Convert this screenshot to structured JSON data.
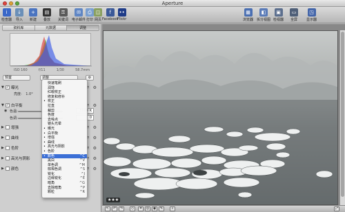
{
  "window": {
    "title": "Aperture"
  },
  "toolbar": {
    "tools": [
      {
        "id": "inspector",
        "label": "检查器",
        "icon": "inspector-icon",
        "color": "#3a68c8",
        "glyph": "i"
      },
      {
        "id": "import",
        "label": "导入",
        "icon": "import-icon",
        "color": "#6a8fb8",
        "glyph": "↓"
      },
      {
        "id": "new",
        "label": "新建",
        "icon": "new-icon",
        "color": "#4a74c0",
        "glyph": "+"
      },
      {
        "id": "stack",
        "label": "叠放",
        "icon": "stack-icon",
        "color": "#333333",
        "glyph": "▤"
      },
      {
        "id": "keywords",
        "label": "关键词",
        "icon": "keyword-icon",
        "color": "#5a5a5a",
        "glyph": "⚿"
      },
      {
        "id": "email",
        "label": "电子邮件",
        "icon": "email-icon",
        "color": "#5f86c4",
        "glyph": "✉"
      },
      {
        "id": "print",
        "label": "打印",
        "icon": "print-icon",
        "color": "#7a9fd0",
        "glyph": "⎙"
      },
      {
        "id": "webpage",
        "label": "网页",
        "icon": "webpage-icon",
        "color": "#8aa060",
        "glyph": "◫"
      },
      {
        "id": "facebook",
        "label": "Facebook",
        "icon": "facebook-icon",
        "color": "#3b5998",
        "glyph": "f"
      },
      {
        "id": "flickr",
        "label": "Flickr",
        "icon": "flickr-icon",
        "color": "#1f3c88",
        "glyph": "••"
      },
      {
        "id": "browser",
        "label": "浏览器",
        "icon": "browser-icon",
        "color": "#4a6fb2",
        "glyph": "▦"
      },
      {
        "id": "split",
        "label": "拆分视图",
        "icon": "split-view-icon",
        "color": "#5a7bb8",
        "glyph": "◧"
      },
      {
        "id": "viewer",
        "label": "检视器",
        "icon": "viewer-icon",
        "color": "#5c6f8e",
        "glyph": "▣"
      },
      {
        "id": "fullscreen",
        "label": "全屏",
        "icon": "fullscreen-icon",
        "color": "#4f5f78",
        "glyph": "▭"
      },
      {
        "id": "crop",
        "label": "显示器",
        "icon": "monitor-icon",
        "color": "#4466aa",
        "glyph": "◳"
      }
    ]
  },
  "left_panel": {
    "tabs": [
      "资料库",
      "元数据",
      "调整"
    ],
    "active_tab": 2,
    "meta": [
      "ISO 160",
      "f/11",
      "1/30",
      "58.7mm"
    ],
    "preset_label": "预置",
    "adjust_label": "调整",
    "sections": [
      {
        "label": "曝光",
        "checked": true,
        "open": true
      },
      {
        "label": "白平衡",
        "checked": true,
        "open": true
      },
      {
        "label": "增强",
        "checked": false,
        "open": false
      },
      {
        "label": "曲线",
        "checked": false,
        "open": false
      },
      {
        "label": "色阶",
        "checked": false,
        "open": false
      },
      {
        "label": "高光与阴影",
        "checked": false,
        "open": false
      },
      {
        "label": "颜色",
        "checked": false,
        "open": false
      }
    ],
    "exposure_sub": "亮度:",
    "exposure_value": "1.0°",
    "wb_sub1": "色温:",
    "wb_sub2": "色调:",
    "wb_val1": "5000 K",
    "wb_val2": "0"
  },
  "adjust_menu": {
    "items": [
      {
        "label": "快速笔刷",
        "shortcut": "",
        "mark": ""
      },
      {
        "label": "润饰",
        "shortcut": "",
        "mark": ""
      },
      {
        "label": "红眼校正",
        "shortcut": "",
        "mark": ""
      },
      {
        "label": "修复和修补",
        "shortcut": "",
        "mark": ""
      },
      {
        "label": "校正",
        "shortcut": "",
        "mark": "•"
      },
      {
        "label": "拉直",
        "shortcut": "",
        "mark": ""
      },
      {
        "label": "裁剪",
        "shortcut": "",
        "mark": ""
      },
      {
        "label": "色度",
        "shortcut": "",
        "mark": ""
      },
      {
        "label": "去噪点",
        "shortcut": "",
        "mark": ""
      },
      {
        "label": "镜头光晕",
        "shortcut": "",
        "mark": ""
      },
      {
        "label": "曝光",
        "shortcut": "",
        "mark": "•"
      },
      {
        "label": "白平衡",
        "shortcut": "",
        "mark": "•"
      },
      {
        "label": "增强",
        "shortcut": "",
        "mark": "•"
      },
      {
        "label": "曲线",
        "shortcut": "",
        "mark": "•"
      },
      {
        "label": "高光与阴影",
        "shortcut": "",
        "mark": "•"
      },
      {
        "label": "色阶",
        "shortcut": "",
        "mark": "•"
      },
      {
        "label": "颜色",
        "shortcut": "^C",
        "mark": "•"
      },
      {
        "label": "黑白",
        "shortcut": "^V",
        "mark": ""
      },
      {
        "label": "单色调",
        "shortcut": "^M",
        "mark": ""
      },
      {
        "label": "棕褐色调",
        "shortcut": "^S",
        "mark": ""
      },
      {
        "label": "锐化",
        "shortcut": "^J",
        "mark": ""
      },
      {
        "label": "边缘锐化",
        "shortcut": "^E",
        "mark": ""
      },
      {
        "label": "暗角",
        "shortcut": "^G",
        "mark": ""
      },
      {
        "label": "去除暗角",
        "shortcut": "^P",
        "mark": ""
      },
      {
        "label": "颗粒",
        "shortcut": "^R",
        "mark": ""
      }
    ],
    "highlighted_index": 16
  },
  "viewer": {
    "rating": "★★★"
  }
}
